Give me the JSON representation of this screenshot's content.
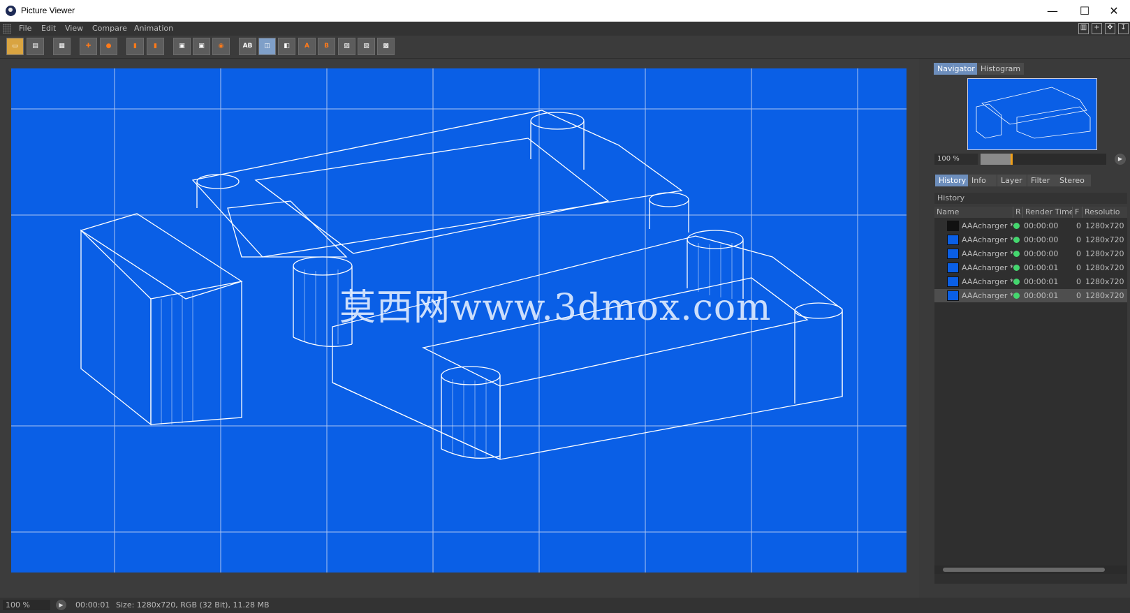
{
  "window": {
    "title": "Picture Viewer",
    "minimize": "—",
    "maximize": "☐",
    "close": "✕"
  },
  "menu": [
    "File",
    "Edit",
    "View",
    "Compare",
    "Animation"
  ],
  "toolbar": {
    "buttons": [
      "open",
      "save",
      "grid",
      "move",
      "user",
      "film-a",
      "film-b",
      "frame-a",
      "frame-b",
      "frame-c",
      "AB",
      "AB-split",
      "AB-overlay",
      "A",
      "B",
      "compare-1",
      "compare-2",
      "compare-3"
    ],
    "ab_label": "AB",
    "a_label": "A",
    "b_label": "B"
  },
  "render": {
    "watermark": "莫西网www.3dmox.com"
  },
  "navigator": {
    "tabs": [
      "Navigator",
      "Histogram"
    ],
    "active_tab": "Navigator",
    "zoom": "100 %",
    "zoom_level": 0.25
  },
  "panel_tabs": [
    "History",
    "Info",
    "Layer",
    "Filter",
    "Stereo"
  ],
  "history": {
    "title": "History",
    "columns": [
      "Name",
      "R",
      "Render Time",
      "F",
      "Resolutio"
    ],
    "rows": [
      {
        "name": "AAAcharger *",
        "time": "00:00:00",
        "f": "0",
        "res": "1280x720",
        "selected": false
      },
      {
        "name": "AAAcharger *",
        "time": "00:00:00",
        "f": "0",
        "res": "1280x720",
        "selected": false
      },
      {
        "name": "AAAcharger *",
        "time": "00:00:00",
        "f": "0",
        "res": "1280x720",
        "selected": false
      },
      {
        "name": "AAAcharger *",
        "time": "00:00:01",
        "f": "0",
        "res": "1280x720",
        "selected": false
      },
      {
        "name": "AAAcharger *",
        "time": "00:00:01",
        "f": "0",
        "res": "1280x720",
        "selected": false
      },
      {
        "name": "AAAcharger *",
        "time": "00:00:01",
        "f": "0",
        "res": "1280x720",
        "selected": true
      }
    ]
  },
  "status": {
    "zoom": "100 %",
    "time": "00:00:01",
    "info": "Size: 1280x720, RGB (32 Bit), 11.28 MB"
  },
  "colors": {
    "render_bg": "#0a5fe6",
    "active_tab": "#6d8ebc",
    "status_dot": "#44d66e",
    "slider_thumb": "#f0a018"
  }
}
